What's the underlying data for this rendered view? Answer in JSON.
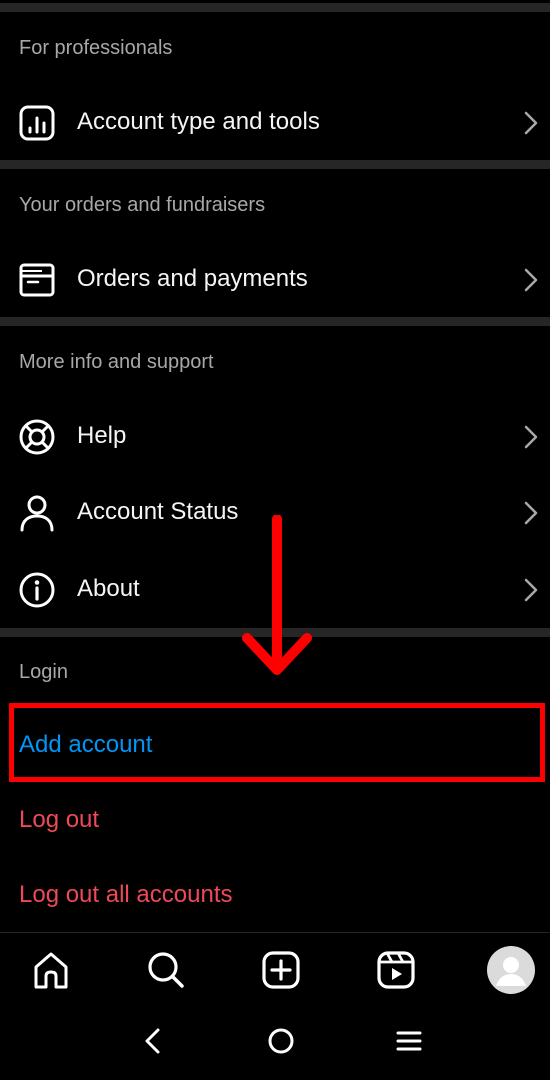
{
  "sections": {
    "professionals": {
      "title": "For professionals",
      "item": {
        "label": "Account type and tools",
        "icon": "bar-chart-icon"
      }
    },
    "orders": {
      "title": "Your orders and fundraisers",
      "item": {
        "label": "Orders and payments",
        "icon": "receipt-icon"
      }
    },
    "support": {
      "title": "More info and support",
      "items": [
        {
          "label": "Help",
          "icon": "lifebuoy-icon"
        },
        {
          "label": "Account Status",
          "icon": "person-icon"
        },
        {
          "label": "About",
          "icon": "info-icon"
        }
      ]
    },
    "login": {
      "title": "Login",
      "add_account": "Add account",
      "log_out": "Log out",
      "log_out_all": "Log out all accounts"
    }
  },
  "bottom_nav": [
    "home-icon",
    "search-icon",
    "create-icon",
    "reels-icon",
    "profile-avatar"
  ],
  "system_nav": [
    "back-icon",
    "home-circle-icon",
    "recents-icon"
  ],
  "colors": {
    "background": "#000000",
    "divider": "#262626",
    "link_blue": "#0095f6",
    "danger_red": "#ed4956",
    "annotation_red": "#ff0000"
  }
}
